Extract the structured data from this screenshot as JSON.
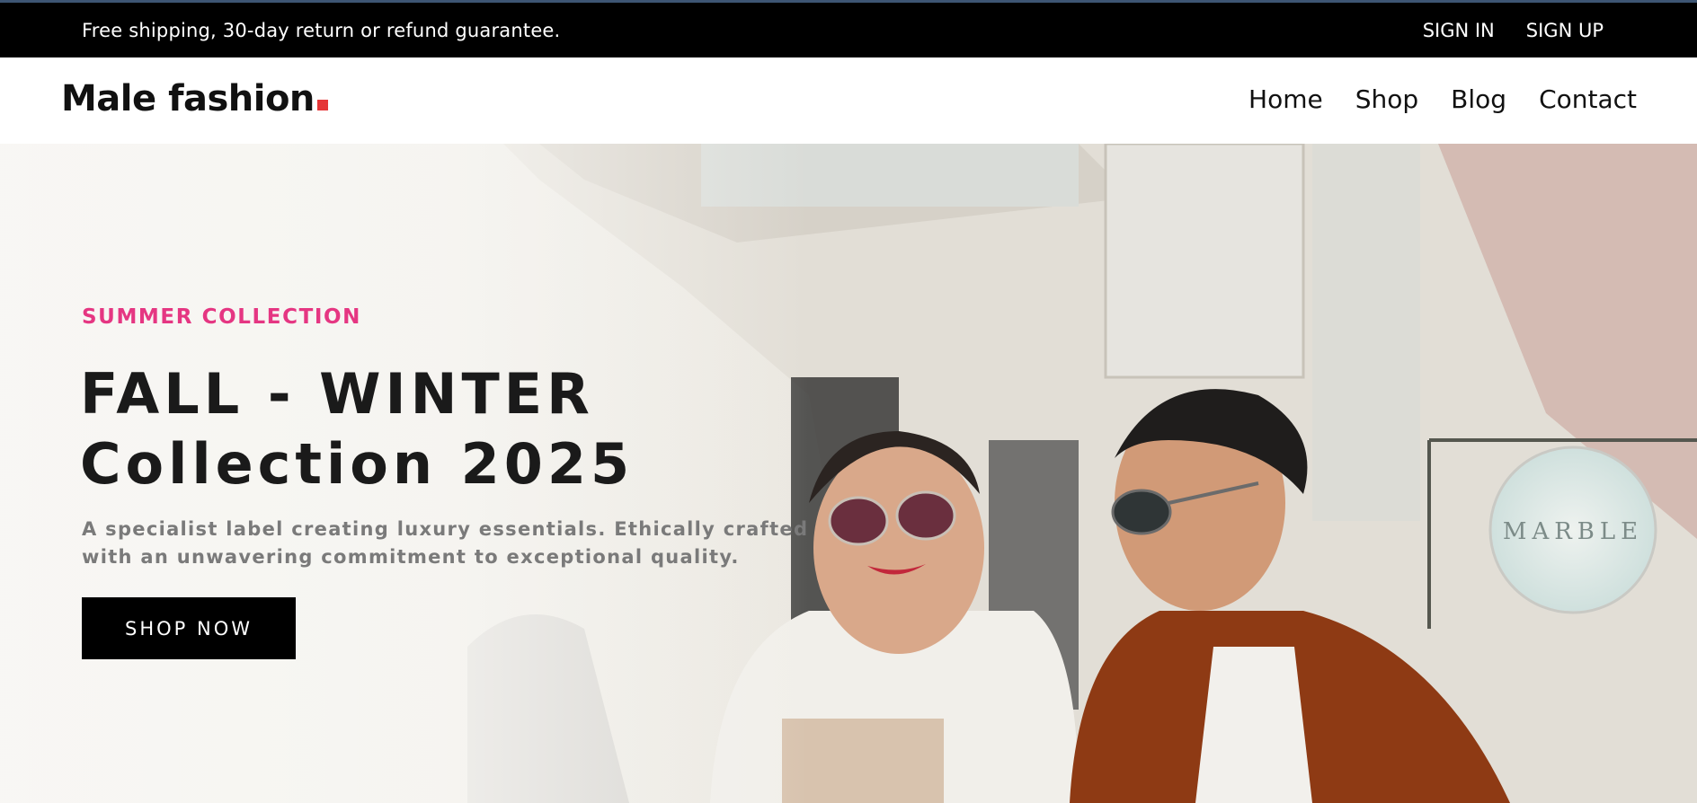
{
  "topbar": {
    "message": "Free shipping, 30-day return or refund guarantee.",
    "sign_in": "SIGN IN",
    "sign_up": "SIGN UP"
  },
  "header": {
    "logo_text": "Male fashion",
    "nav": [
      "Home",
      "Shop",
      "Blog",
      "Contact"
    ]
  },
  "hero": {
    "subtitle": "SUMMER COLLECTION",
    "title_line1": "FALL - WINTER",
    "title_line2": "Collection 2025",
    "description_line1": "A specialist label creating luxury essentials. Ethically crafted",
    "description_line2": "with an unwavering commitment to exceptional quality.",
    "cta": "SHOP NOW"
  },
  "colors": {
    "accent": "#e53682",
    "logo_dot": "#e53637",
    "topbar_bg": "#000000"
  }
}
